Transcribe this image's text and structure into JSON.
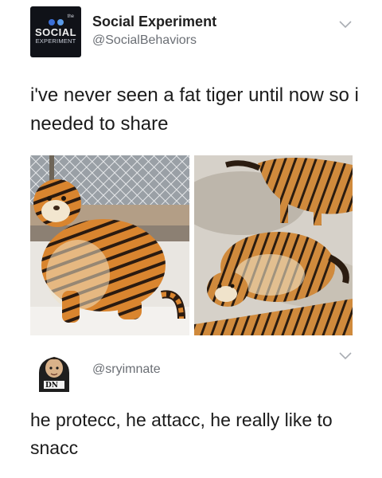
{
  "post1": {
    "avatar": {
      "small_text": "the",
      "line1": "SOCIAL",
      "line2": "EXPERIMENT"
    },
    "display_name": "Social Experiment",
    "handle": "@SocialBehaviors",
    "text": "i've never seen a fat tiger until now so i needed to share",
    "photos": [
      {
        "label": "tiger sitting by fence"
      },
      {
        "label": "tiger lying on snow"
      }
    ]
  },
  "post2": {
    "handle": "@sryimnate",
    "text": "he protecc, he attacc, he really like to snacc"
  },
  "colors": {
    "handle_gray": "#6b6f75",
    "chevron_gray": "#a9adb3",
    "tiger_orange": "#d9852f"
  }
}
